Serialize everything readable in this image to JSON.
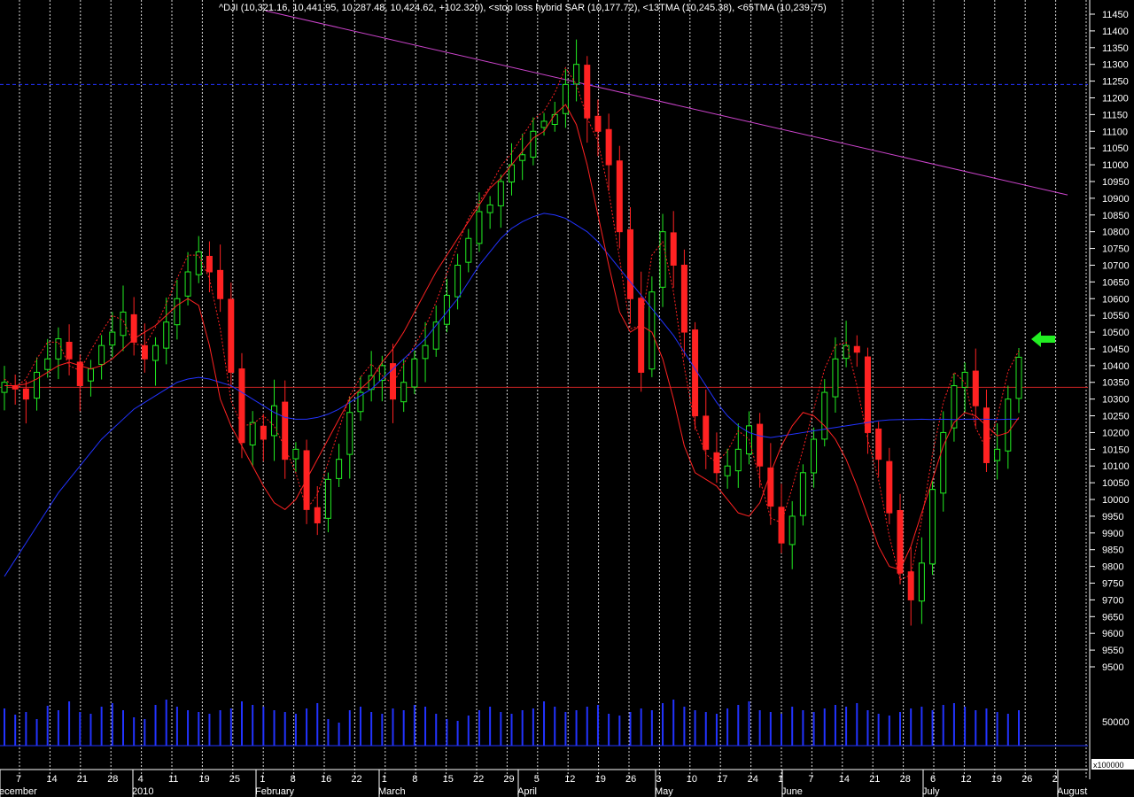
{
  "header": {
    "text": "^DJI (10,321.16, 10,441.95, 10,287.48, 10,424.62, +102.320), <stop loss hybrid SAR (10,177.72), <13TMA (10,245.38), <65TMA (10,239.75)"
  },
  "chart_data": {
    "type": "candlestick",
    "symbol": "^DJI",
    "last_bar": {
      "open": 10321.16,
      "high": 10441.95,
      "low": 10287.48,
      "close": 10424.62,
      "change": 102.32
    },
    "indicators": [
      {
        "name": "stop loss hybrid SAR",
        "value": 10177.72,
        "color": "#ff2222"
      },
      {
        "name": "13TMA",
        "value": 10245.38,
        "color": "#ff2222"
      },
      {
        "name": "65TMA",
        "value": 10239.75,
        "color": "#2233ff"
      }
    ],
    "ylim": [
      9450,
      11500
    ],
    "y_ticks": [
      11450,
      11400,
      11350,
      11300,
      11250,
      11200,
      11150,
      11100,
      11050,
      11000,
      10950,
      10900,
      10850,
      10800,
      10750,
      10700,
      10650,
      10600,
      10550,
      10500,
      10450,
      10400,
      10350,
      10300,
      10250,
      10200,
      10150,
      10100,
      10050,
      10000,
      9950,
      9900,
      9850,
      9800,
      9750,
      9700,
      9650,
      9600,
      9550,
      9500
    ],
    "volume_tick": "50000",
    "volume_scale_label": "x100000",
    "x_day_labels": [
      "7",
      "14",
      "21",
      "28",
      "4",
      "11",
      "19",
      "25",
      "1",
      "8",
      "16",
      "22",
      "1",
      "8",
      "15",
      "22",
      "29",
      "5",
      "12",
      "19",
      "26",
      "3",
      "10",
      "17",
      "24",
      "1",
      "7",
      "14",
      "21",
      "28",
      "6",
      "12",
      "19",
      "26",
      "2"
    ],
    "x_month_labels": [
      "ecember",
      "2010",
      "February",
      "March",
      "April",
      "May",
      "June",
      "July",
      "August"
    ],
    "horizontal_lines": [
      {
        "label": "resistance (dashed blue)",
        "value": 11240,
        "color": "#2233ff",
        "style": "dashed"
      },
      {
        "label": "support (red)",
        "value": 10335,
        "color": "#cc2222",
        "style": "solid"
      }
    ],
    "trendline": {
      "from_value": 11460,
      "to_value": 10910,
      "color": "#cc44cc"
    },
    "close_path": [
      10350,
      10330,
      10300,
      10380,
      10420,
      10480,
      10420,
      10340,
      10390,
      10460,
      10500,
      10560,
      10470,
      10420,
      10460,
      10530,
      10600,
      10680,
      10740,
      10680,
      10600,
      10380,
      10170,
      10230,
      10180,
      10280,
      10120,
      10150,
      9970,
      9930,
      10060,
      10120,
      10260,
      10320,
      10370,
      10400,
      10300,
      10350,
      10420,
      10460,
      10530,
      10610,
      10700,
      10780,
      10860,
      10880,
      10950,
      11000,
      11030,
      11100,
      11130,
      11150,
      11240,
      11300,
      11140,
      11100,
      11000,
      10800,
      10600,
      10380,
      10620,
      10800,
      10700,
      10500,
      10250,
      10150,
      10080,
      10100,
      10150,
      10220,
      10100,
      9980,
      9870,
      9950,
      10080,
      10180,
      10320,
      10420,
      10460,
      10440,
      10200,
      10120,
      9960,
      9780,
      9700,
      9810,
      10030,
      10200,
      10340,
      10380,
      10280,
      10110,
      10150,
      10300,
      10425
    ],
    "ma13_path": [
      10340,
      10340,
      10345,
      10360,
      10380,
      10400,
      10410,
      10400,
      10390,
      10400,
      10420,
      10450,
      10480,
      10500,
      10520,
      10550,
      10580,
      10600,
      10580,
      10460,
      10300,
      10220,
      10160,
      10100,
      10040,
      9990,
      9970,
      10000,
      10060,
      10120,
      10180,
      10240,
      10300,
      10330,
      10360,
      10410,
      10450,
      10500,
      10560,
      10620,
      10680,
      10730,
      10780,
      10830,
      10880,
      10930,
      10960,
      11000,
      11040,
      11080,
      11100,
      11150,
      11180,
      11120,
      11000,
      10850,
      10700,
      10560,
      10500,
      10520,
      10500,
      10420,
      10300,
      10160,
      10080,
      10060,
      10040,
      10000,
      9960,
      9950,
      9990,
      10080,
      10160,
      10220,
      10260,
      10250,
      10220,
      10180,
      10120,
      10040,
      9950,
      9860,
      9800,
      9790,
      9860,
      9960,
      10060,
      10160,
      10230,
      10260,
      10250,
      10220,
      10190,
      10200,
      10245
    ],
    "ma65_path": [
      9770,
      9820,
      9870,
      9920,
      9970,
      10020,
      10060,
      10100,
      10140,
      10180,
      10210,
      10240,
      10270,
      10290,
      10310,
      10330,
      10350,
      10360,
      10365,
      10360,
      10350,
      10340,
      10320,
      10300,
      10280,
      10260,
      10245,
      10240,
      10240,
      10245,
      10255,
      10270,
      10290,
      10310,
      10330,
      10360,
      10390,
      10420,
      10450,
      10480,
      10520,
      10560,
      10600,
      10650,
      10700,
      10740,
      10780,
      10810,
      10830,
      10845,
      10855,
      10850,
      10840,
      10820,
      10800,
      10770,
      10730,
      10690,
      10650,
      10610,
      10570,
      10530,
      10490,
      10440,
      10390,
      10340,
      10290,
      10250,
      10220,
      10200,
      10190,
      10185,
      10190,
      10195,
      10200,
      10205,
      10210,
      10215,
      10220,
      10225,
      10230,
      10235,
      10238,
      10239,
      10239,
      10240,
      10239,
      10240,
      10239,
      10240,
      10240,
      10240,
      10239,
      10240,
      10240
    ],
    "volume_bars": [
      42,
      35,
      38,
      30,
      45,
      40,
      50,
      38,
      36,
      44,
      48,
      40,
      32,
      30,
      46,
      52,
      44,
      40,
      38,
      36,
      40,
      42,
      50,
      46,
      44,
      40,
      38,
      36,
      42,
      48,
      30,
      26,
      40,
      44,
      38,
      36,
      42,
      40,
      46,
      44,
      36,
      30,
      28,
      34,
      40,
      44,
      38,
      36,
      40,
      42,
      50,
      44,
      38,
      40,
      44,
      46,
      36,
      34,
      38,
      42,
      40,
      48,
      52,
      44,
      40,
      38,
      36,
      42,
      46,
      50,
      40,
      38,
      36,
      44,
      40,
      38,
      42,
      46,
      44,
      48,
      40,
      36,
      34,
      38,
      42,
      44,
      40,
      46,
      48,
      44,
      40,
      42,
      38,
      36,
      40
    ]
  }
}
